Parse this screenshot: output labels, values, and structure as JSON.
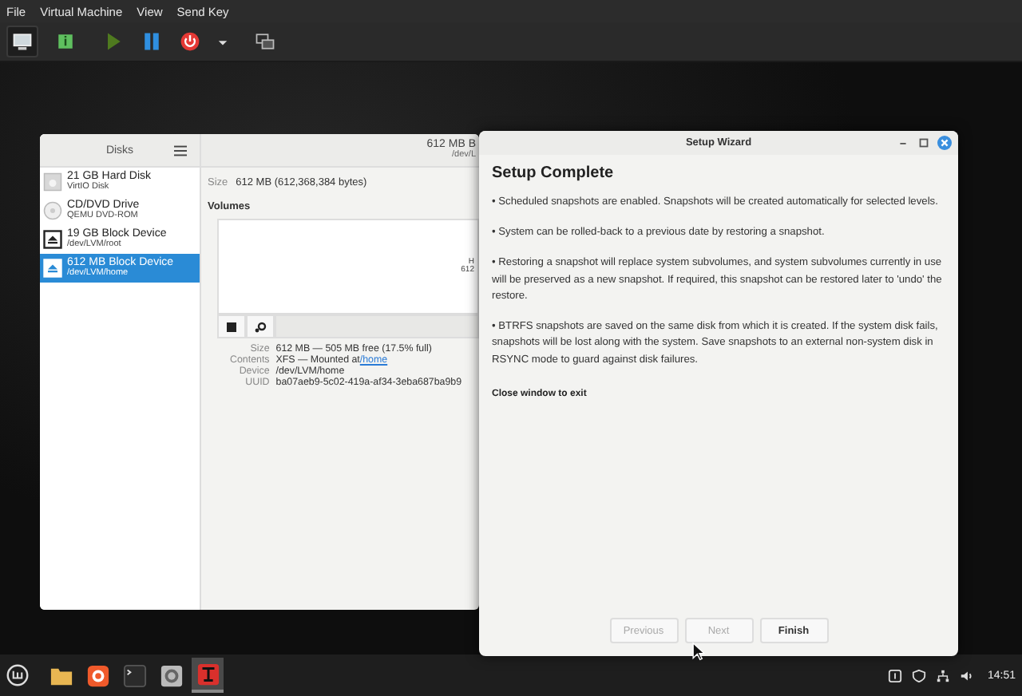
{
  "menu_bar": [
    "File",
    "Virtual Machine",
    "View",
    "Send Key"
  ],
  "disks_window": {
    "title": "Disks",
    "header_title": "612 MB B",
    "header_subtitle": "/dev/L",
    "drives": [
      {
        "name": "21 GB Hard Disk",
        "detail": "VirtIO Disk",
        "kind": "disk",
        "selected": false
      },
      {
        "name": "CD/DVD Drive",
        "detail": "QEMU DVD-ROM",
        "kind": "optical",
        "selected": false
      },
      {
        "name": "19 GB Block Device",
        "detail": "/dev/LVM/root",
        "kind": "block",
        "selected": false
      },
      {
        "name": "612 MB Block Device",
        "detail": "/dev/LVM/home",
        "kind": "block",
        "selected": true
      }
    ],
    "size_label": "Size",
    "size_value": "612 MB (612,368,384 bytes)",
    "volumes_heading": "Volumes",
    "volume_label": [
      "H",
      "612"
    ],
    "details": [
      {
        "label": "Size",
        "value": "612 MB — 505 MB free (17.5% full)"
      },
      {
        "label": "Contents",
        "value": "XFS — Mounted at",
        "link": "/home"
      },
      {
        "label": "Device",
        "value": "/dev/LVM/home"
      },
      {
        "label": "UUID",
        "value": "ba07aeb9-5c02-419a-af34-3eba687ba9b9"
      }
    ]
  },
  "wizard": {
    "title": "Setup Wizard",
    "heading": "Setup Complete",
    "paragraphs": [
      "• Scheduled snapshots are enabled. Snapshots will be created automatically for selected levels.",
      "• System can be rolled-back to a previous date by restoring a snapshot.",
      "• Restoring a snapshot will replace system subvolumes, and system subvolumes currently in use will be preserved as a new snapshot. If required, this snapshot can be restored later to 'undo' the restore.",
      "• BTRFS snapshots are saved on the same disk from which it is created. If the system disk fails, snapshots will be lost along with the system. Save snapshots to an external non-system disk in RSYNC mode to guard against disk failures."
    ],
    "note": "Close window to exit",
    "buttons": [
      {
        "label": "Previous",
        "disabled": true
      },
      {
        "label": "Next",
        "disabled": true
      },
      {
        "label": "Finish",
        "disabled": false
      }
    ]
  },
  "taskbar": {
    "apps": [
      {
        "kind": "folder",
        "selected": false
      },
      {
        "kind": "browser",
        "selected": false
      },
      {
        "kind": "terminal",
        "selected": false
      },
      {
        "kind": "chat",
        "selected": false
      },
      {
        "kind": "timeshift",
        "selected": true
      }
    ],
    "clock": "14:51"
  }
}
